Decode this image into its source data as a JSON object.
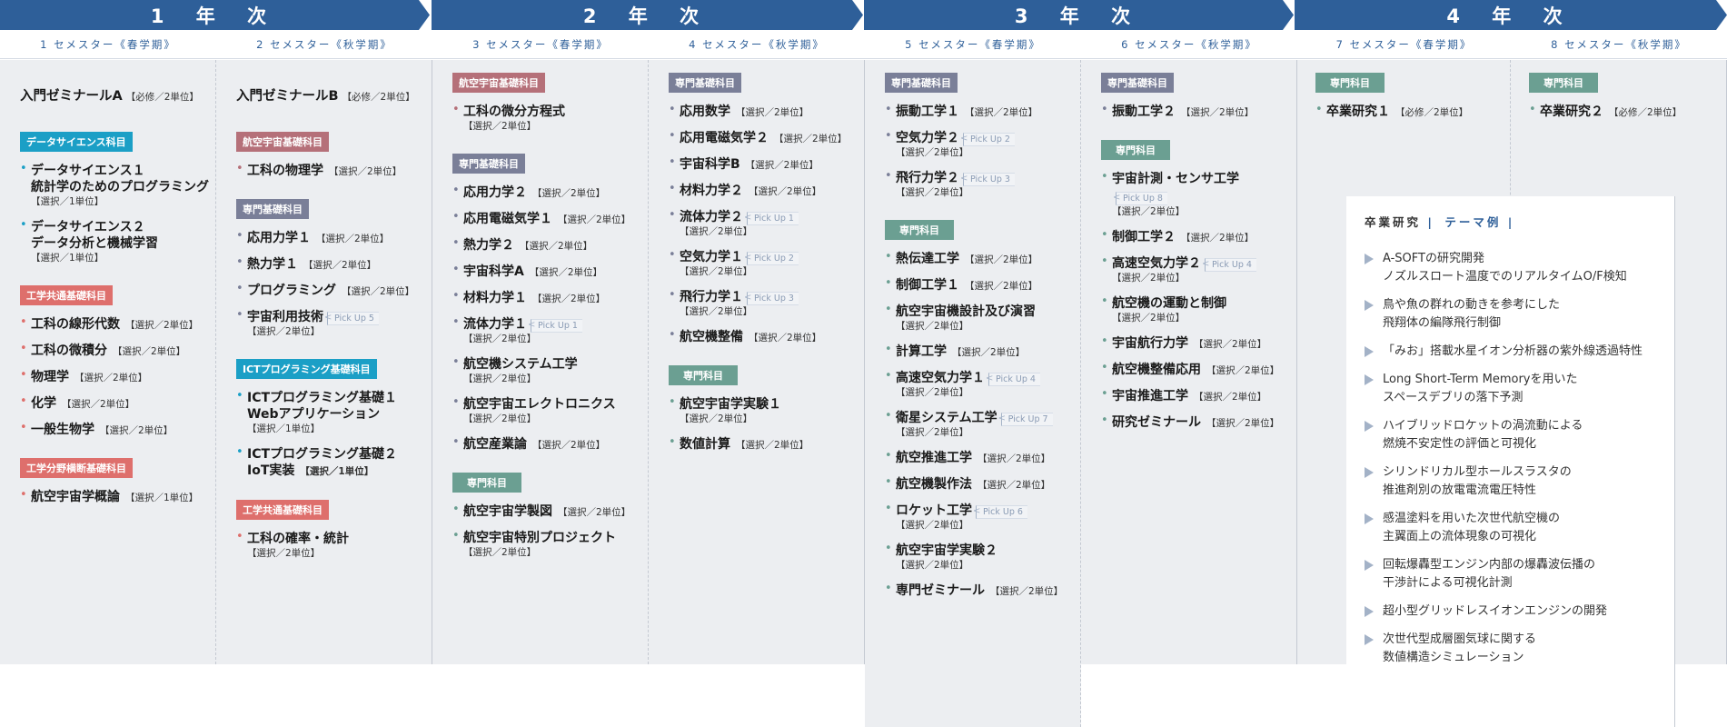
{
  "years": [
    {
      "label": "1 年 次"
    },
    {
      "label": "2 年 次"
    },
    {
      "label": "3 年 次"
    },
    {
      "label": "4 年 次"
    }
  ],
  "semesters": [
    {
      "label": "1 セメスター《春学期》"
    },
    {
      "label": "2 セメスター《秋学期》"
    },
    {
      "label": "3 セメスター《春学期》"
    },
    {
      "label": "4 セメスター《秋学期》"
    },
    {
      "label": "5 セメスター《春学期》"
    },
    {
      "label": "6 セメスター《秋学期》"
    },
    {
      "label": "7 セメスター《春学期》"
    },
    {
      "label": "8 セメスター《秋学期》"
    }
  ],
  "colors": {
    "year_banner": "#2e5f99",
    "cat_data_science": "#1b9fc6",
    "cat_aero_basic": "#b57079",
    "cat_specialized_basic": "#7a7f98",
    "cat_eng_common": "#de6f6c",
    "cat_eng_cross": "#de6f6c",
    "cat_ict": "#1b9fc6",
    "cat_specialized": "#6b9f92"
  },
  "columns": [
    {
      "intro": {
        "name": "入門ゼミナールA",
        "unit": "【必修／2単位】"
      },
      "groups": [
        {
          "category": "データサイエンス科目",
          "color": "#1b9fc6",
          "courses": [
            {
              "name": "データサイエンス１",
              "name2": "統計学のためのプログラミング",
              "unit": "【選択／1単位】",
              "unit_block": true
            },
            {
              "name": "データサイエンス２",
              "name2": "データ分析と機械学習",
              "unit": "【選択／1単位】",
              "unit_block": true
            }
          ]
        },
        {
          "category": "工学共通基礎科目",
          "color": "#de6f6c",
          "courses": [
            {
              "name": "工科の線形代数",
              "unit": "【選択／2単位】"
            },
            {
              "name": "工科の微積分",
              "unit": "【選択／2単位】"
            },
            {
              "name": "物理学",
              "unit": "【選択／2単位】"
            },
            {
              "name": "化学",
              "unit": "【選択／2単位】"
            },
            {
              "name": "一般生物学",
              "unit": "【選択／2単位】"
            }
          ]
        },
        {
          "category": "工学分野横断基礎科目",
          "color": "#de6f6c",
          "courses": [
            {
              "name": "航空宇宙学概論",
              "unit": "【選択／1単位】"
            }
          ]
        }
      ]
    },
    {
      "intro": {
        "name": "入門ゼミナールB",
        "unit": "【必修／2単位】"
      },
      "groups": [
        {
          "category": "航空宇宙基礎科目",
          "color": "#b57079",
          "courses": [
            {
              "name": "工科の物理学",
              "unit": "【選択／2単位】"
            }
          ]
        },
        {
          "category": "専門基礎科目",
          "color": "#7a7f98",
          "courses": [
            {
              "name": "応用力学１",
              "unit": "【選択／2単位】"
            },
            {
              "name": "熱力学１",
              "unit": "【選択／2単位】"
            },
            {
              "name": "プログラミング",
              "unit": "【選択／2単位】"
            },
            {
              "name": "宇宙利用技術",
              "pick": "Pick Up 5",
              "unit": "【選択／2単位】",
              "unit_block": true
            }
          ]
        },
        {
          "category": "ICTプログラミング基礎科目",
          "color": "#1b9fc6",
          "courses": [
            {
              "name": "ICTプログラミング基礎１",
              "name2": "Webアプリケーション",
              "unit": "【選択／1単位】",
              "unit_block": true
            },
            {
              "name": "ICTプログラミング基礎２",
              "name2": "IoT実装",
              "unit": "【選択／1単位】",
              "unit_inline2": true
            }
          ]
        },
        {
          "category": "工学共通基礎科目",
          "color": "#de6f6c",
          "courses": [
            {
              "name": "工科の確率・統計",
              "unit": "【選択／2単位】",
              "unit_block": true
            }
          ]
        }
      ]
    },
    {
      "groups": [
        {
          "category": "航空宇宙基礎科目",
          "color": "#b57079",
          "courses": [
            {
              "name": "工科の微分方程式",
              "unit": "【選択／2単位】",
              "unit_block": true
            }
          ]
        },
        {
          "category": "専門基礎科目",
          "color": "#7a7f98",
          "courses": [
            {
              "name": "応用力学２",
              "unit": "【選択／2単位】"
            },
            {
              "name": "応用電磁気学１",
              "unit": "【選択／2単位】"
            },
            {
              "name": "熱力学２",
              "unit": "【選択／2単位】"
            },
            {
              "name": "宇宙科学A",
              "unit": "【選択／2単位】"
            },
            {
              "name": "材料力学１",
              "unit": "【選択／2単位】"
            },
            {
              "name": "流体力学１",
              "pick": "Pick Up 1",
              "unit": "【選択／2単位】",
              "unit_block": true
            },
            {
              "name": "航空機システム工学",
              "unit": "【選択／2単位】",
              "unit_block": true
            },
            {
              "name": "航空宇宙エレクトロニクス",
              "unit": "【選択／2単位】",
              "unit_block": true
            },
            {
              "name": "航空産業論",
              "unit": "【選択／2単位】"
            }
          ]
        },
        {
          "category": "専門科目",
          "color": "#6b9f92",
          "courses": [
            {
              "name": "航空宇宙学製図",
              "unit": "【選択／2単位】"
            },
            {
              "name": "航空宇宙特別プロジェクト",
              "unit": "【選択／2単位】",
              "unit_block": true
            }
          ]
        }
      ]
    },
    {
      "groups": [
        {
          "category": "専門基礎科目",
          "color": "#7a7f98",
          "courses": [
            {
              "name": "応用数学",
              "unit": "【選択／2単位】"
            },
            {
              "name": "応用電磁気学２",
              "unit": "【選択／2単位】"
            },
            {
              "name": "宇宙科学B",
              "unit": "【選択／2単位】"
            },
            {
              "name": "材料力学２",
              "unit": "【選択／2単位】"
            },
            {
              "name": "流体力学２",
              "pick": "Pick Up 1",
              "unit": "【選択／2単位】",
              "unit_block": true
            },
            {
              "name": "空気力学１",
              "pick": "Pick Up 2",
              "unit": "【選択／2単位】",
              "unit_block": true
            },
            {
              "name": "飛行力学１",
              "pick": "Pick Up 3",
              "unit": "【選択／2単位】",
              "unit_block": true
            },
            {
              "name": "航空機整備",
              "unit": "【選択／2単位】"
            }
          ]
        },
        {
          "category": "専門科目",
          "color": "#6b9f92",
          "courses": [
            {
              "name": "航空宇宙学実験１",
              "unit": "【選択／2単位】",
              "unit_block": true
            },
            {
              "name": "数値計算",
              "unit": "【選択／2単位】"
            }
          ]
        }
      ]
    },
    {
      "groups": [
        {
          "category": "専門基礎科目",
          "color": "#7a7f98",
          "courses": [
            {
              "name": "振動工学１",
              "unit": "【選択／2単位】"
            },
            {
              "name": "空気力学２",
              "pick": "Pick Up 2",
              "unit": "【選択／2単位】",
              "unit_block": true
            },
            {
              "name": "飛行力学２",
              "pick": "Pick Up 3",
              "unit": "【選択／2単位】",
              "unit_block": true
            }
          ]
        },
        {
          "category": "専門科目",
          "color": "#6b9f92",
          "courses": [
            {
              "name": "熱伝達工学",
              "unit": "【選択／2単位】"
            },
            {
              "name": "制御工学１",
              "unit": "【選択／2単位】"
            },
            {
              "name": "航空宇宙機設計及び演習",
              "unit": "【選択／2単位】",
              "unit_block": true
            },
            {
              "name": "計算工学",
              "unit": "【選択／2単位】"
            },
            {
              "name": "高速空気力学１",
              "pick": "Pick Up 4",
              "unit": "【選択／2単位】",
              "unit_block": true
            },
            {
              "name": "衛星システム工学",
              "pick": "Pick Up 7",
              "unit": "【選択／2単位】",
              "unit_block": true
            },
            {
              "name": "航空推進工学",
              "unit": "【選択／2単位】"
            },
            {
              "name": "航空機製作法",
              "unit": "【選択／2単位】"
            },
            {
              "name": "ロケット工学",
              "pick": "Pick Up 6",
              "unit": "【選択／2単位】",
              "unit_block": true
            },
            {
              "name": "航空宇宙学実験２",
              "unit": "【選択／2単位】",
              "unit_block": true
            },
            {
              "name": "専門ゼミナール",
              "unit": "【選択／2単位】"
            }
          ]
        }
      ]
    },
    {
      "groups": [
        {
          "category": "専門基礎科目",
          "color": "#7a7f98",
          "courses": [
            {
              "name": "振動工学２",
              "unit": "【選択／2単位】"
            }
          ]
        },
        {
          "category": "専門科目",
          "color": "#6b9f92",
          "courses": [
            {
              "name": "宇宙計測・センサ工学",
              "pick": "Pick Up 8",
              "unit": "【選択／2単位】",
              "unit_block": true
            },
            {
              "name": "制御工学２",
              "unit": "【選択／2単位】"
            },
            {
              "name": "高速空気力学２",
              "pick": "Pick Up 4",
              "unit": "【選択／2単位】",
              "unit_block": true
            },
            {
              "name": "航空機の運動と制御",
              "unit": "【選択／2単位】",
              "unit_block": true
            },
            {
              "name": "宇宙航行力学",
              "unit": "【選択／2単位】"
            },
            {
              "name": "航空機整備応用",
              "unit": "【選択／2単位】"
            },
            {
              "name": "宇宙推進工学",
              "unit": "【選択／2単位】"
            },
            {
              "name": "研究ゼミナール",
              "unit": "【選択／2単位】"
            }
          ]
        }
      ]
    },
    {
      "groups": [
        {
          "category": "専門科目",
          "color": "#6b9f92",
          "courses": [
            {
              "name": "卒業研究１",
              "unit": "【必修／2単位】"
            }
          ]
        }
      ]
    },
    {
      "groups": [
        {
          "category": "専門科目",
          "color": "#6b9f92",
          "courses": [
            {
              "name": "卒業研究２",
              "unit": "【必修／2単位】"
            }
          ]
        }
      ]
    }
  ],
  "thesis": {
    "title": "卒業研究",
    "subtitle": "テーマ例",
    "themes": [
      {
        "l1": "A-SOFTの研究開発",
        "l2": "ノズルスロート温度でのリアルタイムO/F検知"
      },
      {
        "l1": "鳥や魚の群れの動きを参考にした",
        "l2": "飛翔体の編隊飛行制御"
      },
      {
        "l1": "「みお」搭載水星イオン分析器の紫外線透過特性",
        "l2": ""
      },
      {
        "l1": "Long Short-Term Memoryを用いた",
        "l2": "スペースデブリの落下予測"
      },
      {
        "l1": "ハイブリッドロケットの渦流動による",
        "l2": "燃焼不安定性の評価と可視化"
      },
      {
        "l1": "シリンドリカル型ホールスラスタの",
        "l2": "推進剤別の放電電流電圧特性"
      },
      {
        "l1": "感温塗料を用いた次世代航空機の",
        "l2": "主翼面上の流体現象の可視化"
      },
      {
        "l1": "回転爆轟型エンジン内部の爆轟波伝播の",
        "l2": "干渉計による可視化計測"
      },
      {
        "l1": "超小型グリッドレスイオンエンジンの開発",
        "l2": ""
      },
      {
        "l1": "次世代型成層圏気球に関する",
        "l2": "数値構造シミュレーション"
      }
    ]
  }
}
